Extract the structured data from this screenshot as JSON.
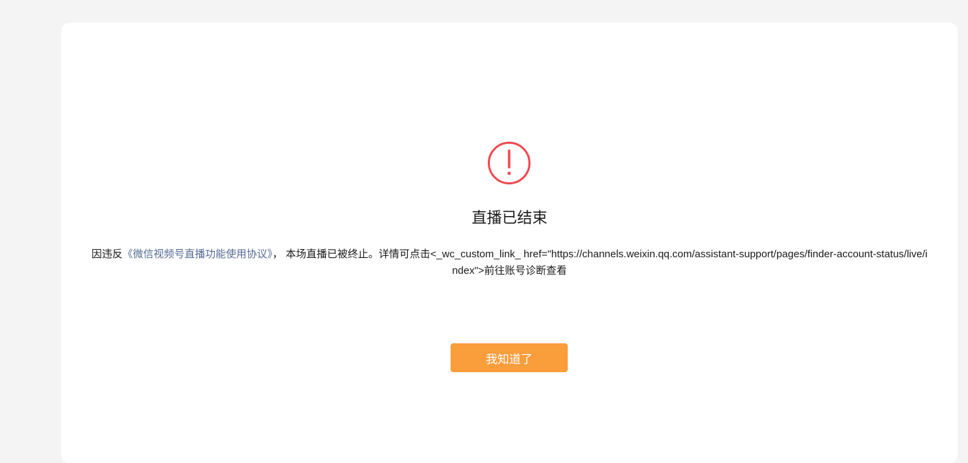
{
  "dialog": {
    "title": "直播已结束",
    "message_prefix": "因违反",
    "agreement_link": "《微信视频号直播功能使用协议》",
    "message_suffix": "， 本场直播已被终止。详情可点击<_wc_custom_link_ href=\"https://channels.weixin.qq.com/assistant-support/pages/finder-account-status/live/index\">前往账号诊断查看",
    "confirm_button": "我知道了",
    "icon": "warning-exclamation-icon"
  },
  "colors": {
    "page_background": "#f4f4f4",
    "card_background": "#ffffff",
    "warning": "#f0484f",
    "link": "#576b95",
    "button": "#fa9d3b",
    "text": "#1a1a1a"
  }
}
